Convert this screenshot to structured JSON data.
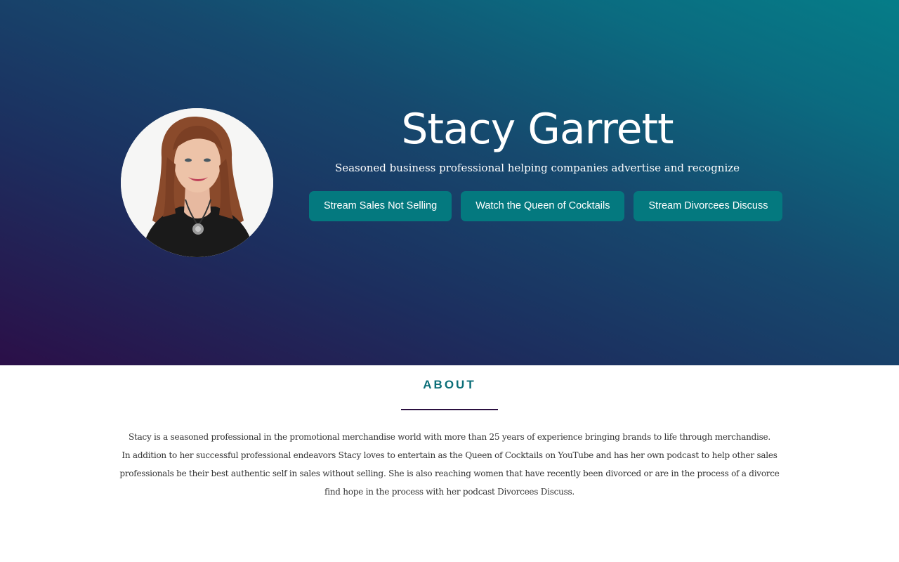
{
  "hero": {
    "name": "Stacy Garrett",
    "tagline": "Seasoned business professional helping companies advertise and recognize",
    "buttons": [
      {
        "label": "Stream Sales Not Selling"
      },
      {
        "label": "Watch the Queen of Cocktails"
      },
      {
        "label": "Stream Divorcees Discuss"
      }
    ]
  },
  "about": {
    "title": "ABOUT",
    "paragraph_1": "Stacy is a seasoned professional in the promotional merchandise world with more than 25 years of experience bringing brands to life through merchandise.",
    "paragraph_2": "In addition to her successful professional endeavors Stacy loves to entertain as the Queen of Cocktails on YouTube and has her own podcast to help other sales professionals be their best authentic self in sales without selling. She is also reaching women that have recently been divorced or are in the process of a divorce find hope in the process with her podcast Divorcees Discuss."
  },
  "colors": {
    "button_bg": "#04797f",
    "accent_text": "#0b6e78",
    "rule": "#2b0f40"
  }
}
